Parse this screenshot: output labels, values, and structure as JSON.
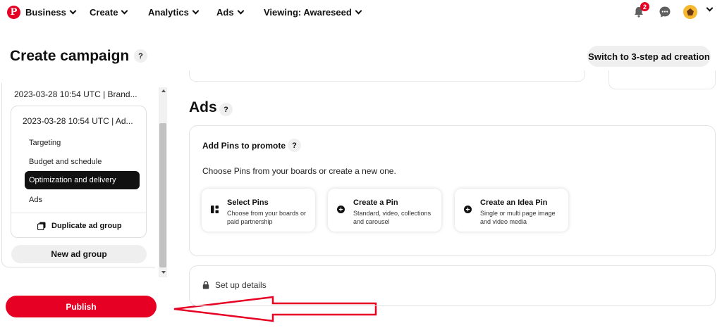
{
  "nav": {
    "business_label": "Business",
    "create_label": "Create",
    "analytics_label": "Analytics",
    "ads_label": "Ads",
    "viewing_label": "Viewing: Awareseed",
    "notification_count": "2",
    "icons": [
      "pinterest-logo",
      "bell-icon",
      "chat-icon",
      "avatar",
      "chevron-down-icon"
    ],
    "brand_color": "#e60023"
  },
  "header": {
    "title": "Create campaign",
    "help": "?",
    "switch_label": "Switch to 3-step ad creation"
  },
  "sidebar": {
    "campaign_label": "2023-03-28 10:54 UTC | Brand...",
    "adgroup_label": "2023-03-28 10:54 UTC | Ad...",
    "items": [
      {
        "label": "Targeting",
        "active": false
      },
      {
        "label": "Budget and schedule",
        "active": false
      },
      {
        "label": "Optimization and delivery",
        "active": true
      },
      {
        "label": "Ads",
        "active": false
      }
    ],
    "duplicate_label": "Duplicate ad group",
    "new_adgroup_label": "New ad group",
    "publish_label": "Publish"
  },
  "main": {
    "ads_heading": "Ads",
    "ads_help": "?",
    "add_pins_title": "Add Pins to promote",
    "add_pins_help": "?",
    "add_pins_desc": "Choose Pins from your boards or create a new one.",
    "options": [
      {
        "title": "Select Pins",
        "desc": "Choose from your boards or paid partnership",
        "icon": "grid-icon"
      },
      {
        "title": "Create a Pin",
        "desc": "Standard, video, collections and carousel",
        "icon": "plus-circle-icon"
      },
      {
        "title": "Create an Idea Pin",
        "desc": "Single or multi page image and video media",
        "icon": "plus-circle-icon"
      }
    ],
    "setup_label": "Set up details"
  },
  "annotation": {
    "arrow_color": "#e60023"
  }
}
